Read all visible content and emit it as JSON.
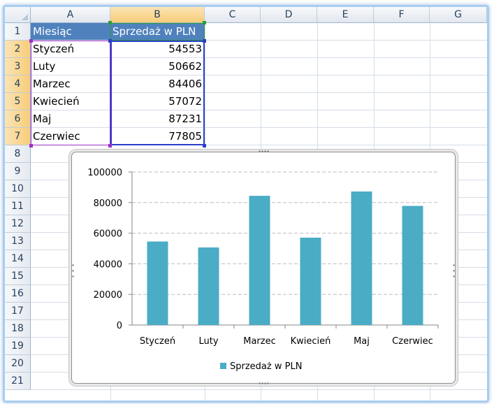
{
  "sheet": {
    "columns": [
      "A",
      "B",
      "C",
      "D",
      "E",
      "F",
      "G"
    ],
    "rows": [
      "1",
      "2",
      "3",
      "4",
      "5",
      "6",
      "7",
      "8",
      "9",
      "10",
      "11",
      "12",
      "13",
      "14",
      "15",
      "16",
      "17",
      "18",
      "19",
      "20",
      "21"
    ],
    "cells": {
      "a1": "Miesiąc",
      "b1": "Sprzedaż w PLN",
      "a2": "Styczeń",
      "b2": "54553",
      "a3": "Luty",
      "b3": "50662",
      "a4": "Marzec",
      "b4": "84406",
      "a5": "Kwiecień",
      "b5": "57072",
      "a6": "Maj",
      "b6": "87231",
      "a7": "Czerwiec",
      "b7": "77805"
    },
    "colors": {
      "header_fill": "#4f81bd",
      "header_text": "#ffffff"
    }
  },
  "chart_data": {
    "type": "bar",
    "categories": [
      "Styczeń",
      "Luty",
      "Marzec",
      "Kwiecień",
      "Maj",
      "Czerwiec"
    ],
    "series": [
      {
        "name": "Sprzedaż w PLN",
        "values": [
          54553,
          50662,
          84406,
          57072,
          87231,
          77805
        ],
        "color": "#4bacc6"
      }
    ],
    "title": "",
    "xlabel": "",
    "ylabel": "",
    "ylim": [
      0,
      100000
    ],
    "yticks": [
      "0",
      "20000",
      "40000",
      "60000",
      "80000",
      "100000"
    ],
    "grid": true,
    "legend_position": "bottom"
  }
}
